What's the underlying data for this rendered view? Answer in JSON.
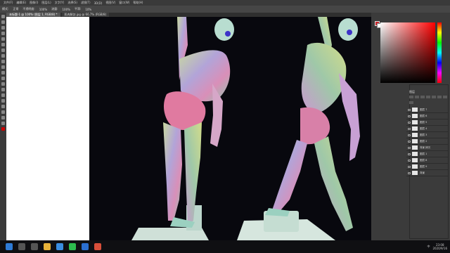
{
  "menu": [
    "文件(F)",
    "编辑(E)",
    "图像(I)",
    "图层(L)",
    "文字(Y)",
    "选择(S)",
    "滤镜(T)",
    "3D(D)",
    "视图(V)",
    "窗口(W)",
    "帮助(H)"
  ],
  "options": [
    "模式:",
    "正常",
    "不透明度:",
    "100%",
    "流量:",
    "100%",
    "平滑:",
    "10%"
  ],
  "tabs": [
    {
      "label": "未标题-1 @ 100% (图层 1, RGB/8) *",
      "active": true
    },
    {
      "label": "肌肉解剖.jpg @ 66.7% (RGB/8)",
      "active": false
    }
  ],
  "layers_header": "图层",
  "layers": [
    {
      "name": "图层 7"
    },
    {
      "name": "图层 6"
    },
    {
      "name": "图层 5"
    },
    {
      "name": "图层 4"
    },
    {
      "name": "图层 3"
    },
    {
      "name": "图层 2"
    },
    {
      "name": "背景 拷贝"
    },
    {
      "name": "图层 1"
    },
    {
      "name": "图层 8"
    },
    {
      "name": "图层 9"
    },
    {
      "name": "背景"
    }
  ],
  "colors": {
    "foreground": "#c8242a",
    "background": "#ffffff"
  },
  "taskbar": {
    "apps": [
      {
        "icon": "windows-start-icon",
        "color": "#2e7bd6"
      },
      {
        "icon": "search-icon",
        "color": "#555"
      },
      {
        "icon": "task-view-icon",
        "color": "#555"
      },
      {
        "icon": "explorer-icon",
        "color": "#e8b33a"
      },
      {
        "icon": "browser-icon",
        "color": "#3a8de0"
      },
      {
        "icon": "wechat-icon",
        "color": "#2dbb4e"
      },
      {
        "icon": "photoshop-icon",
        "color": "#2b6fd1"
      },
      {
        "icon": "media-icon",
        "color": "#d84f3a"
      }
    ],
    "tray_text": "中",
    "time": "23:08",
    "date": "2020/9/16"
  }
}
